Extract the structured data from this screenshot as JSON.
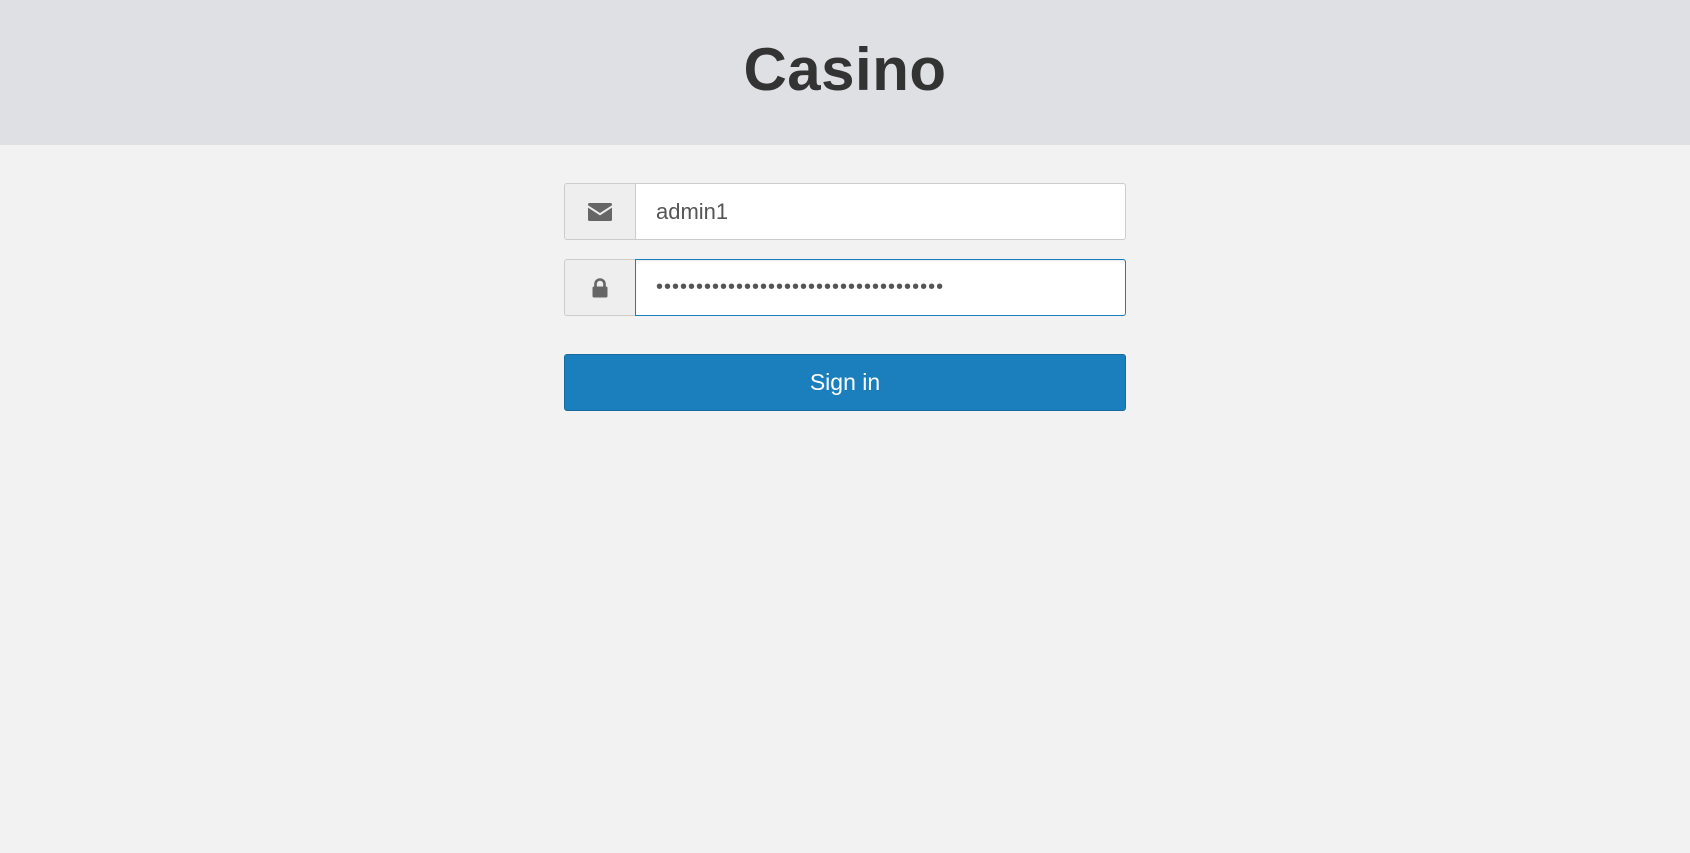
{
  "header": {
    "title": "Casino"
  },
  "login": {
    "email": {
      "icon": "envelope-icon",
      "value": "admin1"
    },
    "password": {
      "icon": "lock-icon",
      "value": "••••••••••••••••••••••••••••••••••••"
    },
    "submit_label": "Sign in"
  },
  "colors": {
    "header_bg": "#dfe0e4",
    "page_bg": "#f2f2f2",
    "accent": "#1b7fbd",
    "title_text": "#333333"
  }
}
